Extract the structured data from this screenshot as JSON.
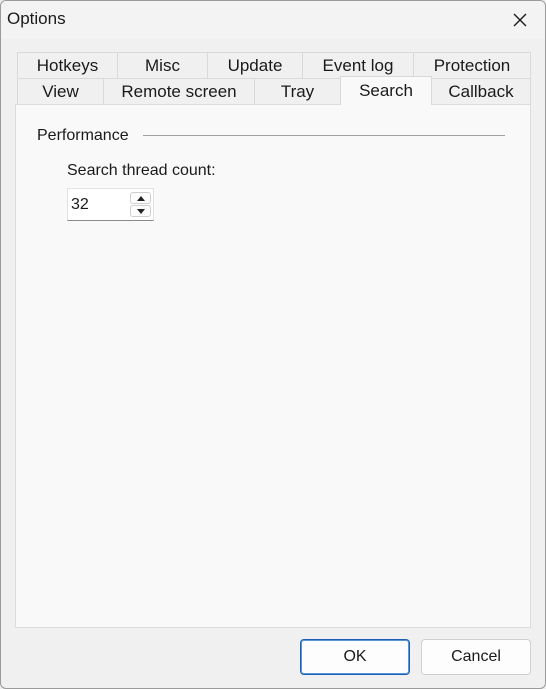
{
  "window": {
    "title": "Options"
  },
  "tabs": {
    "row1": [
      "Hotkeys",
      "Misc",
      "Update",
      "Event log",
      "Protection"
    ],
    "row2": [
      "View",
      "Remote screen",
      "Tray",
      "Search",
      "Callback"
    ],
    "selected": "Search"
  },
  "panel": {
    "group_label": "Performance",
    "thread_label": "Search thread count:",
    "thread_value": "32"
  },
  "buttons": {
    "ok": "OK",
    "cancel": "Cancel"
  },
  "icons": {
    "close": "close-icon",
    "up": "chevron-up-icon",
    "down": "chevron-down-icon"
  },
  "colors": {
    "default_button_border": "#1a5fb4",
    "panel_bg": "#f9f9f9"
  }
}
